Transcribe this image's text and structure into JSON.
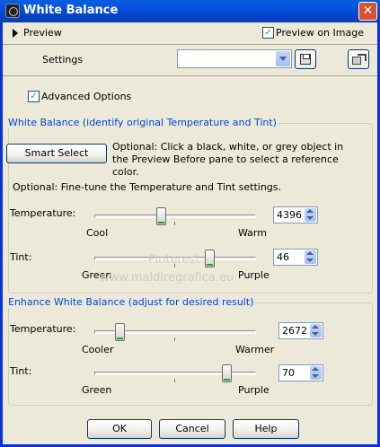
{
  "window": {
    "title": "White Balance"
  },
  "top": {
    "preview_label": "Preview",
    "preview_on_image_label": "Preview on Image",
    "preview_on_image_checked": true
  },
  "settings": {
    "label": "Settings",
    "combo_value": ""
  },
  "advanced_options": {
    "label": "Advanced Options",
    "checked": true
  },
  "white_balance_group": {
    "title": "White Balance (identify original Temperature and Tint)",
    "smart_select_label": "Smart Select",
    "smart_select_help": "Optional: Click a black, white, or grey object in the Preview Before pane to select a reference color.",
    "finetune_text": "Optional: Fine-tune the Temperature and Tint settings.",
    "temperature": {
      "label": "Temperature:",
      "min_label": "Cool",
      "max_label": "Warm",
      "value": "4396",
      "level": 0.44
    },
    "tint": {
      "label": "Tint:",
      "min_label": "Green",
      "max_label": "Purple",
      "value": "46",
      "level": 0.72
    }
  },
  "enhance_group": {
    "title": "Enhance White Balance (adjust for desired result)",
    "temperature": {
      "label": "Temperature:",
      "min_label": "Cooler",
      "max_label": "Warmer",
      "value": "2672",
      "level": 0.15
    },
    "tint": {
      "label": "Tint:",
      "min_label": "Green",
      "max_label": "Purple",
      "value": "70",
      "level": 0.85
    }
  },
  "watermark": {
    "line1": "Pinterest",
    "line2": "www.maldiregrafica.eu"
  },
  "buttons": {
    "ok": "OK",
    "cancel": "Cancel",
    "help": "Help"
  },
  "colors": {
    "title_bar": "#0554e3",
    "dialog_bg": "#ece9d8",
    "group_title": "#0046d5",
    "close_button": "#d8532f"
  }
}
